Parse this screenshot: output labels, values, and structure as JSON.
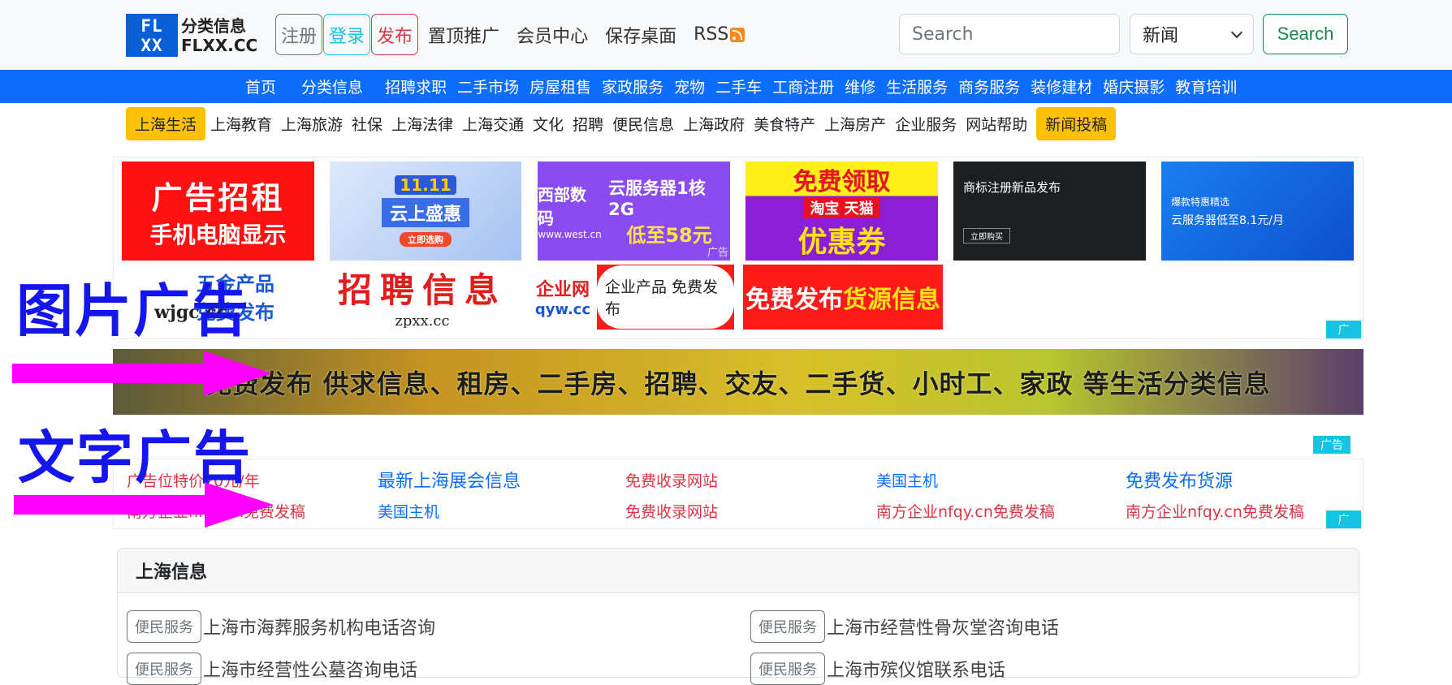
{
  "logo": {
    "mark_line1": "FL",
    "mark_line2": "XX",
    "cn": "分类信息",
    "en": "FLXX.CC"
  },
  "topnav": {
    "register": "注册",
    "login": "登录",
    "publish": "发布",
    "links": [
      "置顶推广",
      "会员中心",
      "保存桌面",
      "RSS"
    ]
  },
  "search": {
    "placeholder": "Search",
    "category": "新闻",
    "button": "Search"
  },
  "mainnav": [
    "首页",
    "分类信息",
    "招聘求职",
    "二手市场",
    "房屋租售",
    "家政服务",
    "宠物",
    "二手车",
    "工商注册",
    "维修",
    "生活服务",
    "商务服务",
    "装修建材",
    "婚庆摄影",
    "教育培训"
  ],
  "subnav": [
    "上海生活",
    "上海教育",
    "上海旅游",
    "社保",
    "上海法律",
    "上海交通",
    "文化",
    "招聘",
    "便民信息",
    "上海政府",
    "美食特产",
    "上海房产",
    "企业服务",
    "网站帮助",
    "新闻投稿"
  ],
  "image_ads": {
    "ad1": {
      "line1": "广告招租",
      "line2": "手机电脑显示"
    },
    "ad2": {
      "line1": "11.11",
      "line2": "云上盛惠",
      "line3": "立即选购"
    },
    "ad3": {
      "brand": "西部数码",
      "url": "www.west.cn",
      "line1": "云服务器1核2G",
      "line2": "低至58元",
      "tag": "广告"
    },
    "ad4": {
      "line1": "免费领取",
      "line2": "淘宝 天猫",
      "line3": "优惠券"
    },
    "ad5": {
      "line1": "商标注册新品发布",
      "line2": "立即购买"
    },
    "ad6": {
      "line1": "爆款特惠精选",
      "line2": "云服务器低至8.1元/月"
    },
    "ad7": {
      "line1": "五金产品",
      "line2": "免费发布",
      "url": "wjgc.cc"
    },
    "ad8": {
      "line1": "招聘信息",
      "url": "zpxx.cc"
    },
    "ad9": {
      "line1": "企业网",
      "url": "qyw.cc"
    },
    "ad10": {
      "line1": "企业产品 免费发布"
    },
    "ad11": {
      "line1": "免费发布",
      "line2": "货源信息"
    },
    "tag": "广"
  },
  "banner": {
    "text": "免费发布 供求信息、租房、二手房、招聘、交友、二手货、小时工、家政 等生活分类信息"
  },
  "text_ads": {
    "tag_top": "广告",
    "tag_bottom": "广",
    "row1": [
      "广告位特价20元/年",
      "最新上海展会信息",
      "免费收录网站",
      "美国主机",
      "免费发布货源"
    ],
    "row2": [
      "南方企业nfqy.cn免费发稿",
      "美国主机",
      "免费收录网站",
      "南方企业nfqy.cn免费发稿",
      "南方企业nfqy.cn免费发稿"
    ]
  },
  "overlays": {
    "image_label": "图片广告",
    "text_label": "文字广告"
  },
  "info": {
    "title": "上海信息",
    "items": [
      {
        "badge": "便民服务",
        "text": "上海市海葬服务机构电话咨询"
      },
      {
        "badge": "便民服务",
        "text": "上海市经营性骨灰堂咨询电话"
      },
      {
        "badge": "便民服务",
        "text": "上海市经营性公墓咨询电话"
      },
      {
        "badge": "便民服务",
        "text": "上海市殡仪馆联系电话"
      }
    ]
  },
  "colors": {
    "primary": "#0d6efd",
    "warning": "#ffc107",
    "danger": "#dc3545",
    "info": "#17c2e3",
    "success": "#198754",
    "overlay": "#1515ee",
    "arrow": "#ff00ff"
  }
}
